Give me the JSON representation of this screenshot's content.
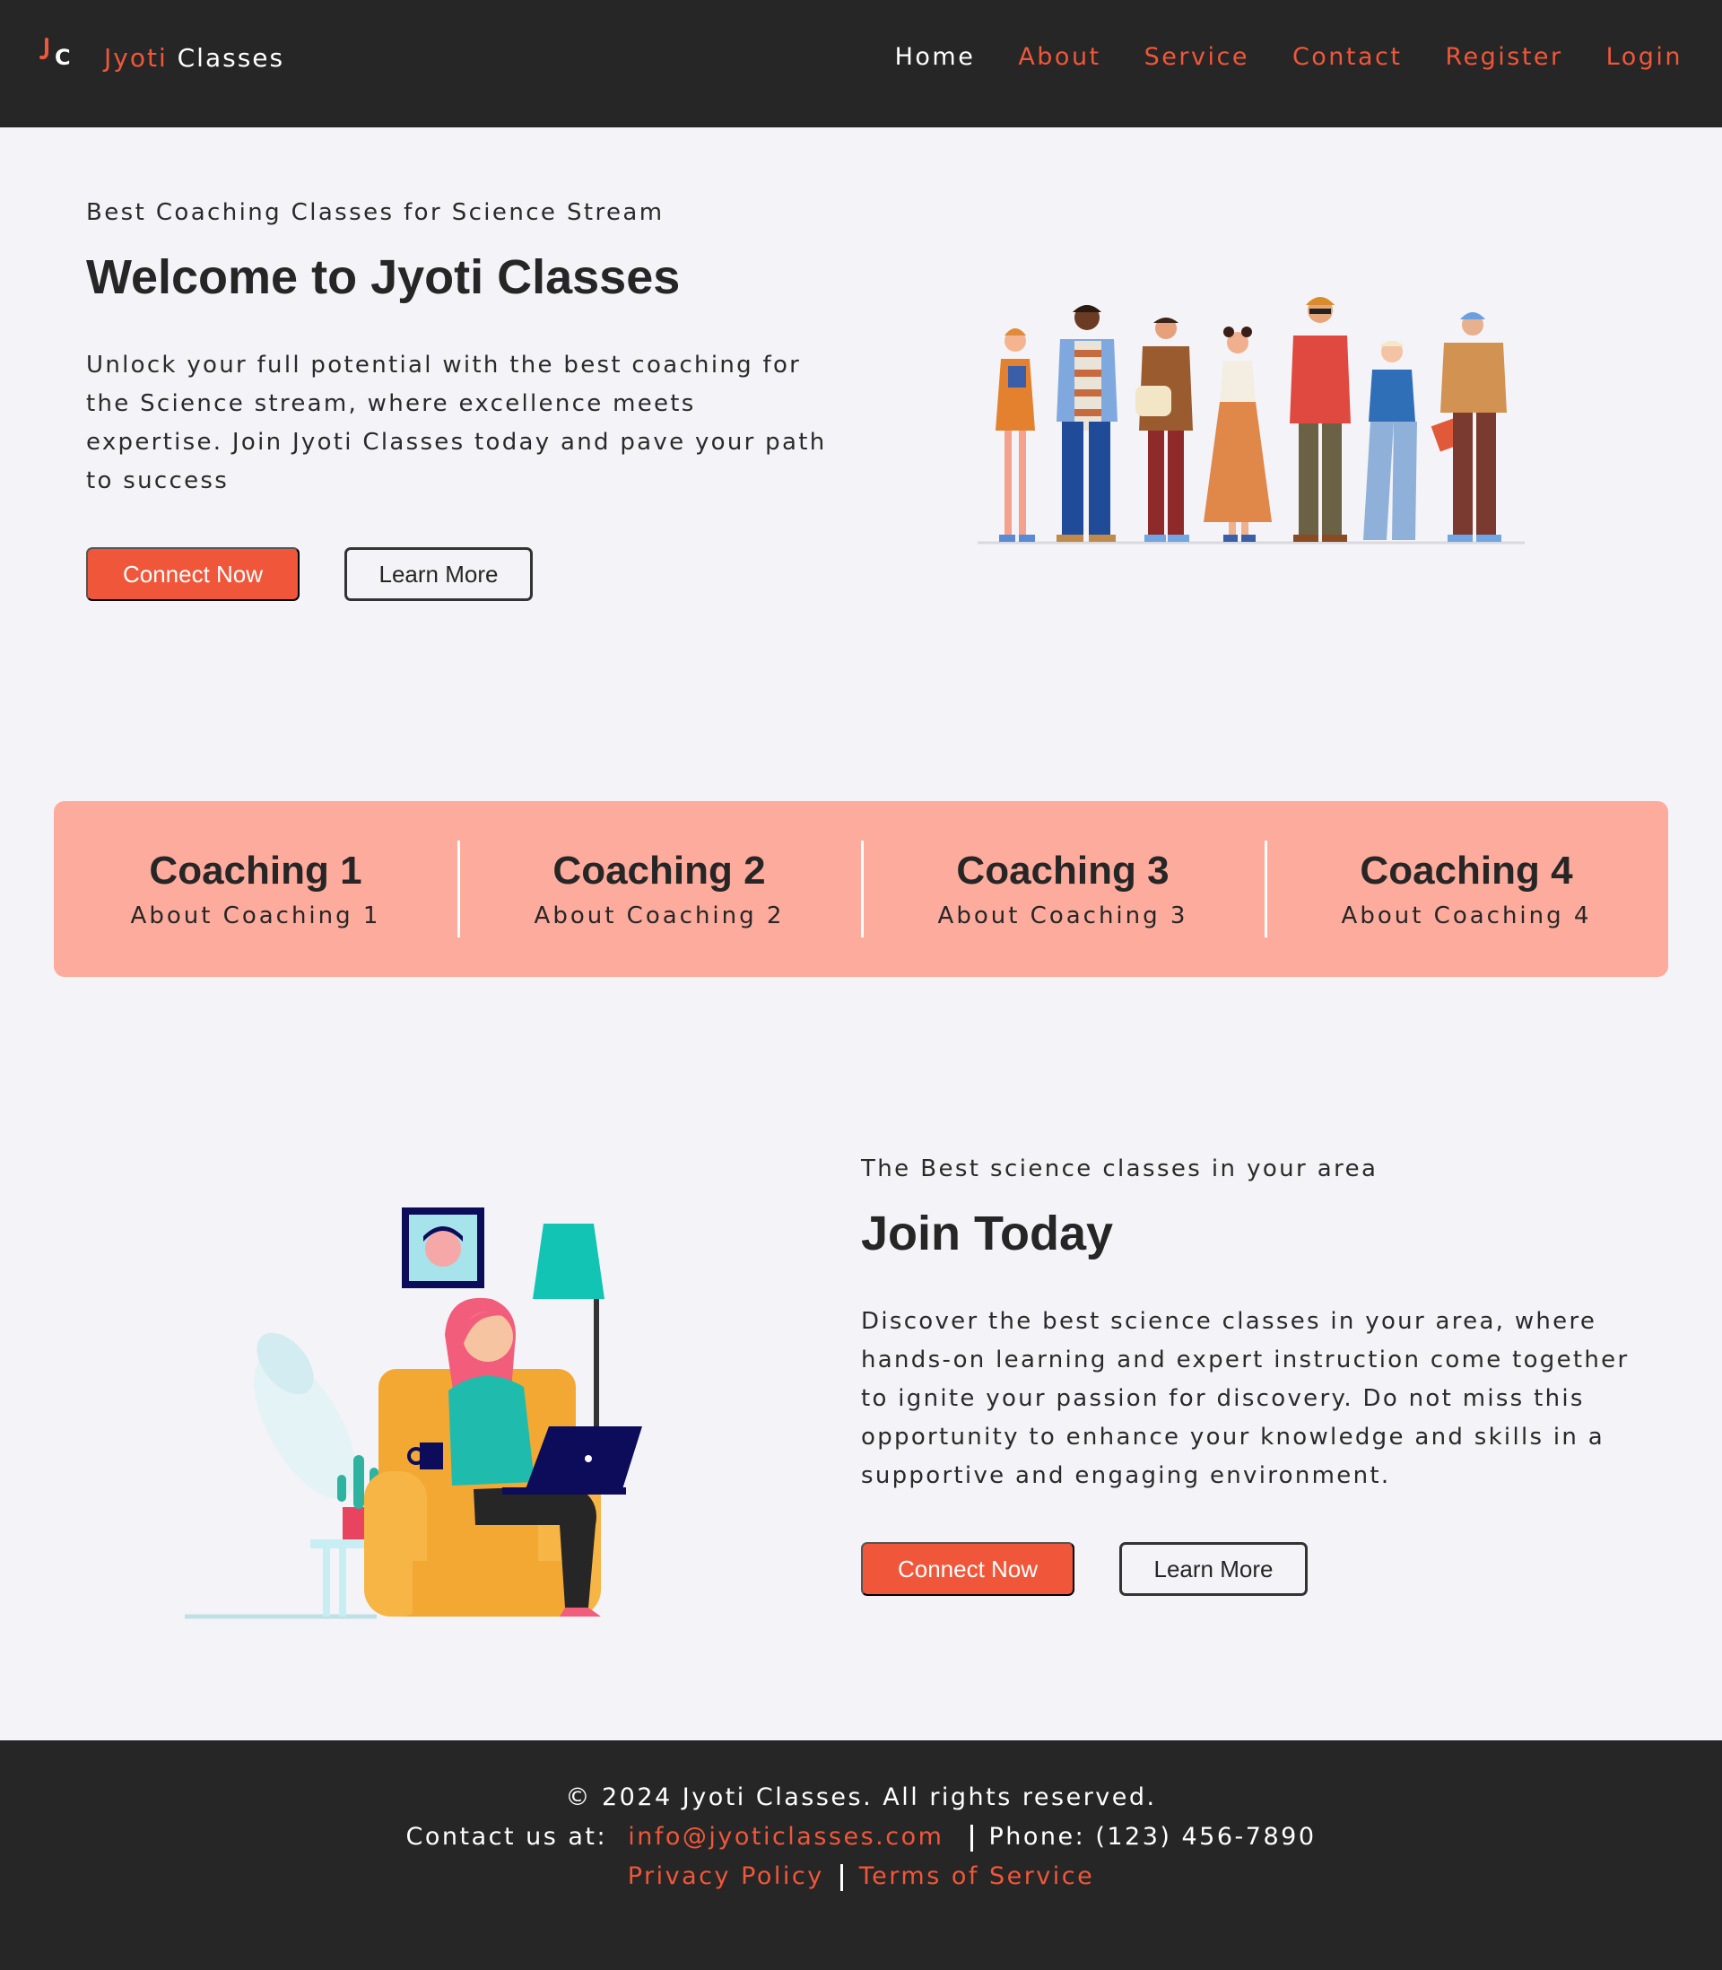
{
  "brand": {
    "logo_text": "JC",
    "name_accent": "Jyoti",
    "name_plain": "Classes",
    "accent_color": "#f0573a"
  },
  "nav": {
    "items": [
      {
        "label": "Home",
        "active": true
      },
      {
        "label": "About"
      },
      {
        "label": "Service"
      },
      {
        "label": "Contact"
      },
      {
        "label": "Register"
      },
      {
        "label": "Login"
      }
    ]
  },
  "hero": {
    "eyebrow": "Best Coaching Classes for Science Stream",
    "title": "Welcome to Jyoti Classes",
    "body": "Unlock your full potential with the best coaching for the Science stream, where excellence meets expertise. Join Jyoti Classes today and pave your path to success",
    "primary_label": "Connect Now",
    "secondary_label": "Learn More",
    "illustration": "group-of-students-illustration"
  },
  "coaching": [
    {
      "title": "Coaching 1",
      "subtitle": "About Coaching 1"
    },
    {
      "title": "Coaching 2",
      "subtitle": "About Coaching 2"
    },
    {
      "title": "Coaching 3",
      "subtitle": "About Coaching 3"
    },
    {
      "title": "Coaching 4",
      "subtitle": "About Coaching 4"
    }
  ],
  "join": {
    "eyebrow": "The Best science classes in your area",
    "title": "Join Today",
    "body": "Discover the best science classes in your area, where hands-on learning and expert instruction come together to ignite your passion for discovery. Do not miss this opportunity to enhance your knowledge and skills in a supportive and engaging environment.",
    "primary_label": "Connect Now",
    "secondary_label": "Learn More",
    "illustration": "woman-with-laptop-illustration"
  },
  "footer": {
    "copyright": "© 2024 Jyoti Classes. All rights reserved.",
    "contact_prefix": "Contact us at:",
    "email": "info@jyoticlasses.com",
    "phone": "Phone: (123) 456-7890",
    "privacy": "Privacy Policy",
    "terms": "Terms of Service"
  },
  "colors": {
    "nav_bg": "#262626",
    "accent": "#f0573a",
    "page_bg": "#f4f3f7",
    "coaching_bg": "#fdab9c"
  }
}
